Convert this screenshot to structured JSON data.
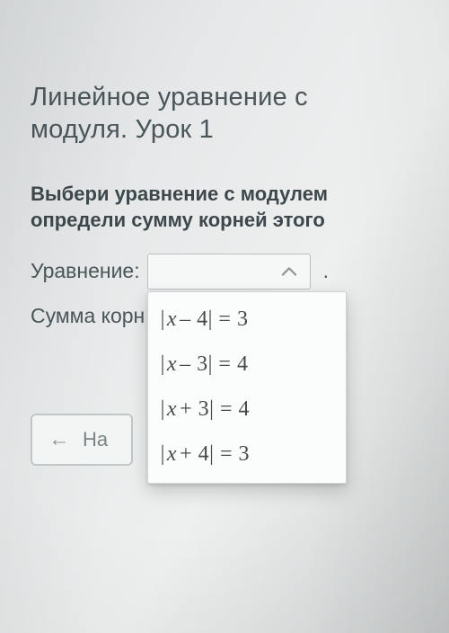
{
  "title": "Линейное уравнение с\nмодуля. Урок 1",
  "instruction": "Выбери уравнение с модулем\nопредели сумму корней этого",
  "labels": {
    "equation": "Уравнение:",
    "sum_prefix": "Сумма корн",
    "period": "."
  },
  "dropdown": {
    "open": true,
    "selected": "",
    "options": [
      {
        "display": "|x – 4| = 3",
        "lhs_sign": "–",
        "lhs_const": "4",
        "rhs": "3"
      },
      {
        "display": "|x – 3| = 4",
        "lhs_sign": "–",
        "lhs_const": "3",
        "rhs": "4"
      },
      {
        "display": "|x + 3| = 4",
        "lhs_sign": "+",
        "lhs_const": "3",
        "rhs": "4"
      },
      {
        "display": "|x + 4| = 3",
        "lhs_sign": "+",
        "lhs_const": "4",
        "rhs": "3"
      }
    ]
  },
  "back_button": {
    "label": "На"
  }
}
